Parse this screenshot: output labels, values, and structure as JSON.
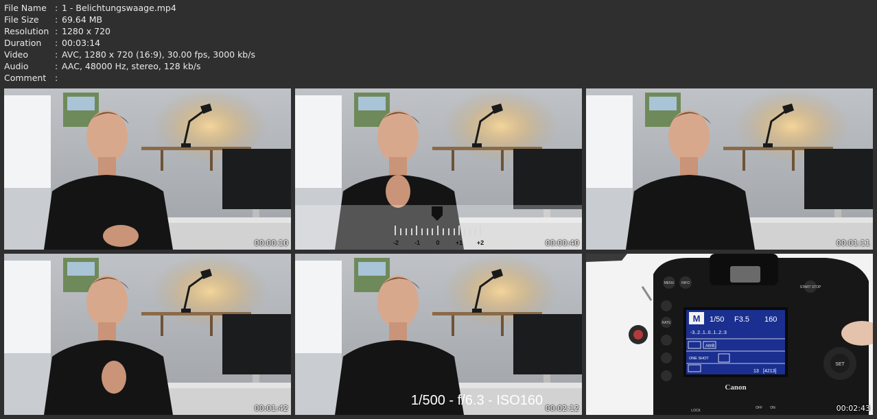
{
  "meta": [
    {
      "key": "File Name",
      "value": "1 - Belichtungswaage.mp4"
    },
    {
      "key": "File Size",
      "value": "69.64 MB"
    },
    {
      "key": "Resolution",
      "value": "1280 x 720"
    },
    {
      "key": "Duration",
      "value": "00:03:14"
    },
    {
      "key": "Video",
      "value": "AVC, 1280 x 720 (16:9), 30.00 fps, 3000 kb/s"
    },
    {
      "key": "Audio",
      "value": "AAC, 48000 Hz, stereo, 128 kb/s"
    },
    {
      "key": "Comment",
      "value": ""
    }
  ],
  "separator": ":",
  "thumbs": [
    {
      "time": "00:00:10"
    },
    {
      "time": "00:00:40",
      "scale": [
        "-2",
        "-1",
        "0",
        "+1",
        "+2"
      ]
    },
    {
      "time": "00:01:11"
    },
    {
      "time": "00:01:42"
    },
    {
      "time": "00:02:12",
      "caption": "1/500 - f/6.3 - ISO160"
    },
    {
      "time": "00:02:43",
      "camera": {
        "mode": "M",
        "shutter": "1/50",
        "aperture": "F3.5",
        "iso": "160",
        "exposure_scale": "-3..2..1..0..1..2.:3",
        "wb": "AWB",
        "af": "ONE SHOT",
        "shots": "13",
        "remaining": "[4213]",
        "brand": "Canon",
        "labels": [
          "MENU",
          "INFO",
          "START STOP",
          "RATE",
          "SET",
          "LOCK",
          "OFF",
          "ON"
        ]
      }
    }
  ]
}
